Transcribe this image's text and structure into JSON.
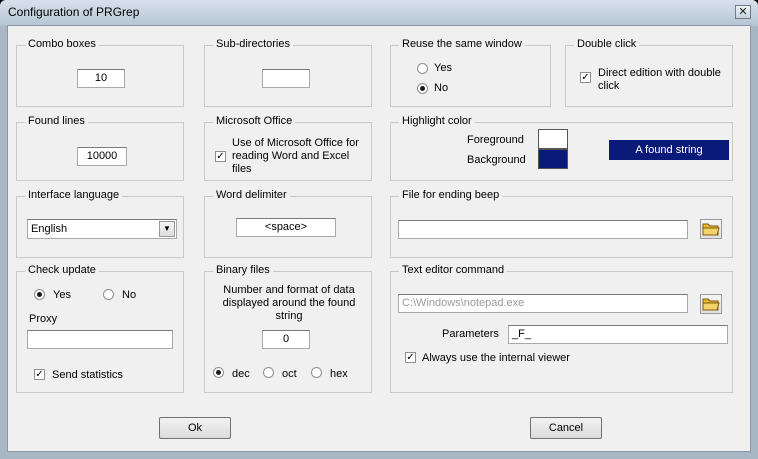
{
  "window": {
    "title": "Configuration of PRGrep",
    "close_glyph": "✕"
  },
  "colors": {
    "foreground": "#ffffff",
    "background": "#0a1a78",
    "sample_text": "#ffffff"
  },
  "combo_boxes": {
    "title": "Combo boxes",
    "value": "10"
  },
  "sub_directories": {
    "title": "Sub-directories",
    "value": ""
  },
  "reuse_window": {
    "title": "Reuse the same window",
    "yes": "Yes",
    "no": "No",
    "selected": "no"
  },
  "double_click": {
    "title": "Double click",
    "label": "Direct edition with double click",
    "checked": true
  },
  "found_lines": {
    "title": "Found lines",
    "value": "10000"
  },
  "microsoft_office": {
    "title": "Microsoft Office",
    "label": "Use of Microsoft Office for reading Word and Excel files",
    "checked": true
  },
  "highlight_color": {
    "title": "Highlight color",
    "foreground_label": "Foreground",
    "background_label": "Background",
    "sample": "A found string"
  },
  "interface_language": {
    "title": "Interface language",
    "value": "English"
  },
  "word_delimiter": {
    "title": "Word delimiter",
    "value": "<space>"
  },
  "ending_beep": {
    "title": "File for ending beep",
    "value": ""
  },
  "check_update": {
    "title": "Check update",
    "yes": "Yes",
    "no": "No",
    "selected": "yes",
    "proxy_label": "Proxy",
    "proxy_value": "",
    "send_statistics": "Send statistics",
    "send_checked": true
  },
  "binary_files": {
    "title": "Binary files",
    "description": "Number and format of data displayed around the found string",
    "value": "0",
    "dec": "dec",
    "oct": "oct",
    "hex": "hex",
    "selected": "dec"
  },
  "text_editor": {
    "title": "Text editor command",
    "path": "C:\\Windows\\notepad.exe",
    "parameters_label": "Parameters",
    "parameters_value": "_F_",
    "internal_viewer": "Always use the internal viewer",
    "internal_checked": true
  },
  "buttons": {
    "ok": "Ok",
    "cancel": "Cancel"
  },
  "check_glyph": "✓",
  "dropdown_glyph": "▼"
}
